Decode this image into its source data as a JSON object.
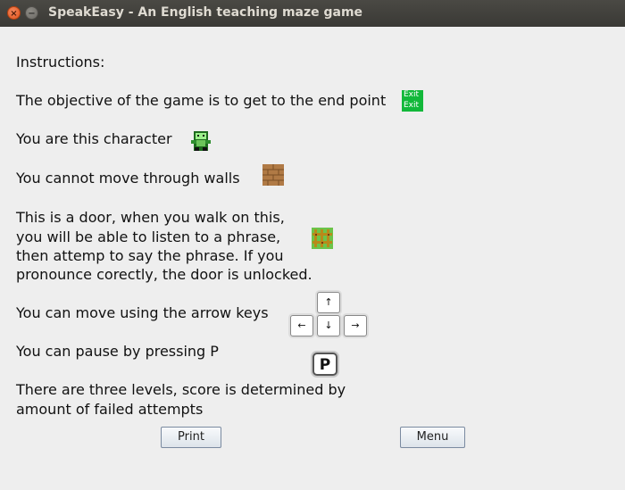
{
  "window": {
    "title": "SpeakEasy - An English teaching maze game",
    "close_glyph": "×",
    "min_glyph": "−"
  },
  "instructions": {
    "heading": "Instructions:",
    "objective": "The objective of the game is to get to the end point",
    "character": "You are this character",
    "walls": "You cannot move through walls",
    "door_lines": [
      "This is a door, when you walk on this,",
      "you will be able to listen to a phrase,",
      "then attemp to say the phrase. If you",
      "pronounce corectly, the door is unlocked."
    ],
    "arrows": "You can move using the arrow keys",
    "pause": "You can pause by pressing P",
    "levels_lines": [
      "There are three levels, score is determined by",
      "amount of failed attempts"
    ]
  },
  "exit_tile": {
    "line1": "Exit",
    "line2": "Exit",
    "color": "#12b83a"
  },
  "keys": {
    "up": "↑",
    "down": "↓",
    "left": "←",
    "right": "→",
    "pause": "P"
  },
  "buttons": {
    "print": "Print",
    "menu": "Menu"
  },
  "icons": {
    "exit": "exit-tile-icon",
    "character": "player-character-icon",
    "wall": "brick-wall-icon",
    "door": "door-tile-icon"
  }
}
